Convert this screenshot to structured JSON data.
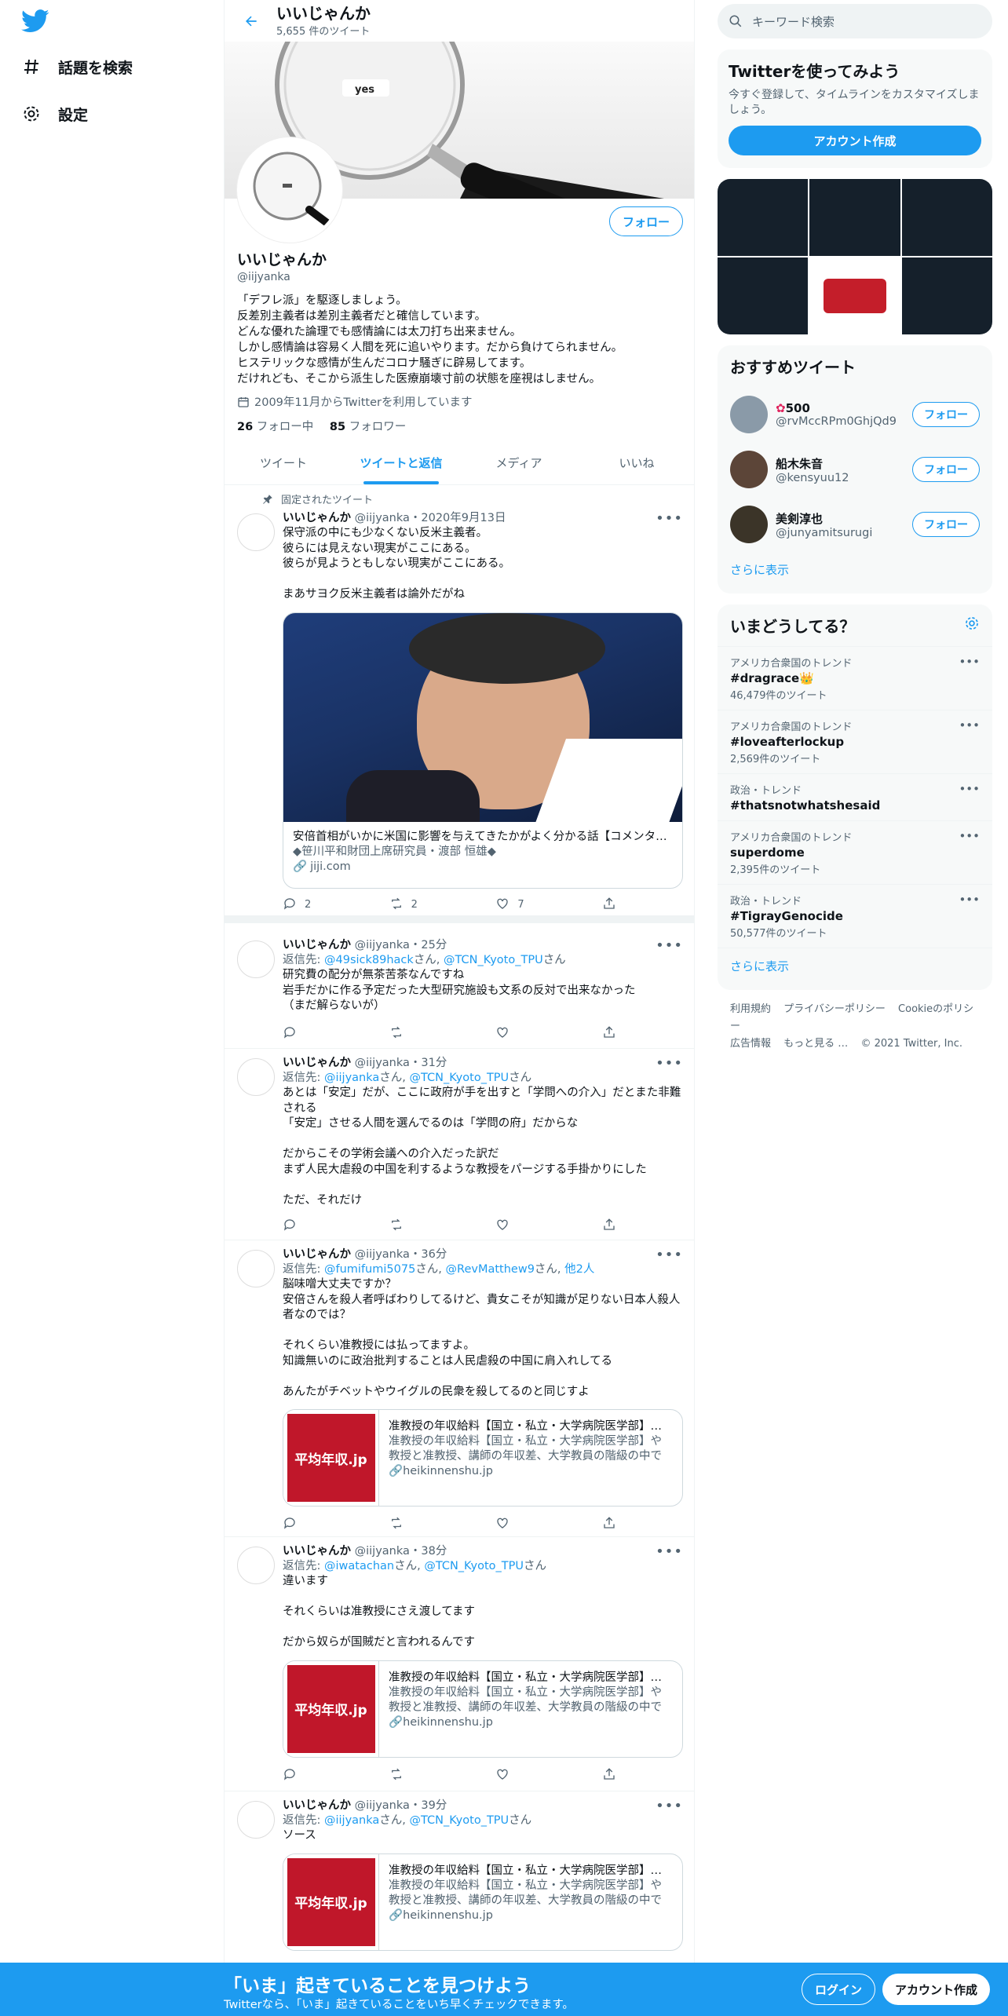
{
  "nav": {
    "explore": "話題を検索",
    "settings": "設定"
  },
  "header": {
    "title": "いいじゃんか",
    "subtitle": "5,655 件のツイート"
  },
  "banner": {
    "text": "yes"
  },
  "profile": {
    "follow": "フォロー",
    "name": "いいじゃんか",
    "handle": "@iijyanka",
    "bio": "「デフレ派」を駆逐しましょう。\n反差別主義者は差別主義者だと確信しています。\nどんな優れた論理でも感情論には太刀打ち出来ません。\nしかし感情論は容易く人間を死に追いやります。だから負けてられません。\nヒステリックな感情が生んだコロナ騒ぎに辟易してます。\nだけれども、そこから派生した医療崩壊寸前の状態を座視はしません。",
    "joined": "2009年11月からTwitterを利用しています",
    "following_count": "26",
    "following_label": "フォロー中",
    "followers_count": "85",
    "followers_label": "フォロワー"
  },
  "tabs": [
    "ツイート",
    "ツイートと返信",
    "メディア",
    "いいね"
  ],
  "pinned_label": "固定されたツイート",
  "tweets": [
    {
      "name": "いいじゃんか",
      "meta": "@iijyanka・2020年9月13日",
      "text": "保守派の中にも少なくない反米主義者。\n彼らには見えない現実がここにある。\n彼らが見ようともしない現実がここにある。\n\nまあサヨク反米主義者は論外だがね",
      "card_title": "安倍首相がいかに米国に影響を与えてきたかがよく分かる話【コメンタリー】",
      "card_desc": "◆笹川平和財団上席研究員・渡部 恒雄◆",
      "card_url": "jiji.com",
      "replies": "2",
      "retweets": "2",
      "likes": "7"
    },
    {
      "name": "いいじゃんか",
      "meta": "@iijyanka・25分",
      "reply_prefix": "返信先: ",
      "reply_to": "@49sick89hack",
      "reply_mid": "さん, ",
      "reply_to2": "@TCN_Kyoto_TPU",
      "reply_suffix": "さん",
      "text": "研究費の配分が無茶苦茶なんですね\n岩手だかに作る予定だった大型研究施設も文系の反対で出来なかった\n（まだ解らないが）"
    },
    {
      "name": "いいじゃんか",
      "meta": "@iijyanka・31分",
      "reply_prefix": "返信先: ",
      "reply_to": "@iijyanka",
      "reply_mid": "さん, ",
      "reply_to2": "@TCN_Kyoto_TPU",
      "reply_suffix": "さん",
      "text": "あとは「安定」だが、ここに政府が手を出すと「学問への介入」だとまた非難される\n「安定」させる人間を選んでるのは「学問の府」だからな\n\nだからこその学術会議への介入だった訳だ\nまず人民大虐殺の中国を利するような教授をパージする手掛かりにした\n\nただ、それだけ"
    },
    {
      "name": "いいじゃんか",
      "meta": "@iijyanka・36分",
      "reply_prefix": "返信先: ",
      "reply_to": "@fumifumi5075",
      "reply_mid": "さん, ",
      "reply_to2": "@RevMatthew9",
      "reply_mid2": "さん, ",
      "reply_to3": "他2人",
      "text": "脳味噌大丈夫ですか？\n安倍さんを殺人者呼ばわりしてるけど、貴女こそが知識が足りない日本人殺人者なのでは？\n\nそれくらい准教授には払ってますよ。\n知識無いのに政治批判することは人民虐殺の中国に肩入れしてる\n\nあんたがチベットやウイグルの民衆を殺してるのと同じすよ",
      "card_thumb": "平均年収.jp",
      "card_title": "准教授の年収給料【国立・私立・大学病院医学部】平均年収.jp",
      "card_desc": "准教授の年収給料【国立・私立・大学病院医学部】や教授と准教授、講師の年収差、大学教員の階級の中での位置づけなど",
      "card_url": "heikinnenshu.jp"
    },
    {
      "name": "いいじゃんか",
      "meta": "@iijyanka・38分",
      "reply_prefix": "返信先: ",
      "reply_to": "@iwatachan",
      "reply_mid": "さん, ",
      "reply_to2": "@TCN_Kyoto_TPU",
      "reply_suffix": "さん",
      "text": "違います\n\nそれくらいは准教授にさえ渡してます\n\nだから奴らが国賊だと言われるんです",
      "card_thumb": "平均年収.jp",
      "card_title": "准教授の年収給料【国立・私立・大学病院医学部】平均年収.jp",
      "card_desc": "准教授の年収給料【国立・私立・大学病院医学部】や教授と准教授、講師の年収差、大学教員の階級の中での位置づけなど",
      "card_url": "heikinnenshu.jp"
    },
    {
      "name": "いいじゃんか",
      "meta": "@iijyanka・39分",
      "reply_prefix": "返信先: ",
      "reply_to": "@iijyanka",
      "reply_mid": "さん, ",
      "reply_to2": "@TCN_Kyoto_TPU",
      "reply_suffix": "さん",
      "text": "ソース",
      "card_thumb": "平均年収.jp",
      "card_title": "准教授の年収給料【国立・私立・大学病院医学部】平均年収.jp",
      "card_desc": "准教授の年収給料【国立・私立・大学病院医学部】や教授と准教授、講師の年収差、大学教員の階級の中での位置づけなど",
      "card_url": "heikinnenshu.jp"
    }
  ],
  "right": {
    "search_placeholder": "キーワード検索",
    "join_title": "Twitterを使ってみよう",
    "join_text": "今すぐ登録して、タイムラインをカスタマイズしましょう。",
    "join_button": "アカウント作成",
    "who_title": "おすすめツイート",
    "who": [
      {
        "name": "500",
        "handle": "@rvMccRPm0GhjQd9",
        "button": "フォロー",
        "avatar_color": "#8a9aa8"
      },
      {
        "name": "船木朱音",
        "handle": "@kensyuu12",
        "button": "フォロー",
        "avatar_color": "#5c4538"
      },
      {
        "name": "美剣淳也",
        "handle": "@junyamitsurugi",
        "button": "フォロー",
        "avatar_color": "#3b3428"
      }
    ],
    "who_more": "さらに表示",
    "trends_title": "いまどうしてる？",
    "trends": [
      {
        "context": "アメリカ合衆国のトレンド",
        "keyword": "#dragrace👑",
        "count": "46,479件のツイート"
      },
      {
        "context": "アメリカ合衆国のトレンド",
        "keyword": "#loveafterlockup",
        "count": "2,569件のツイート"
      },
      {
        "context": "政治・トレンド",
        "keyword": "#thatsnotwhatshesaid",
        "count": ""
      },
      {
        "context": "アメリカ合衆国のトレンド",
        "keyword": "superdome",
        "count": "2,395件のツイート"
      },
      {
        "context": "政治・トレンド",
        "keyword": "#TigrayGenocide",
        "count": "50,577件のツイート"
      }
    ],
    "trends_more": "さらに表示",
    "footer": [
      "利用規約",
      "プライバシーポリシー",
      "Cookieのポリシー",
      "広告情報",
      "もっと見る …",
      "© 2021 Twitter, Inc."
    ]
  },
  "bottom": {
    "title": "「いま」起きていることを見つけよう",
    "subtitle": "Twitterなら、「いま」起きていることをいち早くチェックできます。",
    "login": "ログイン",
    "signup": "アカウント作成"
  },
  "colors": {
    "accent": "#1d9bf0",
    "text": "#0f1419",
    "muted": "#536471",
    "card_brand": "#c0172a"
  }
}
